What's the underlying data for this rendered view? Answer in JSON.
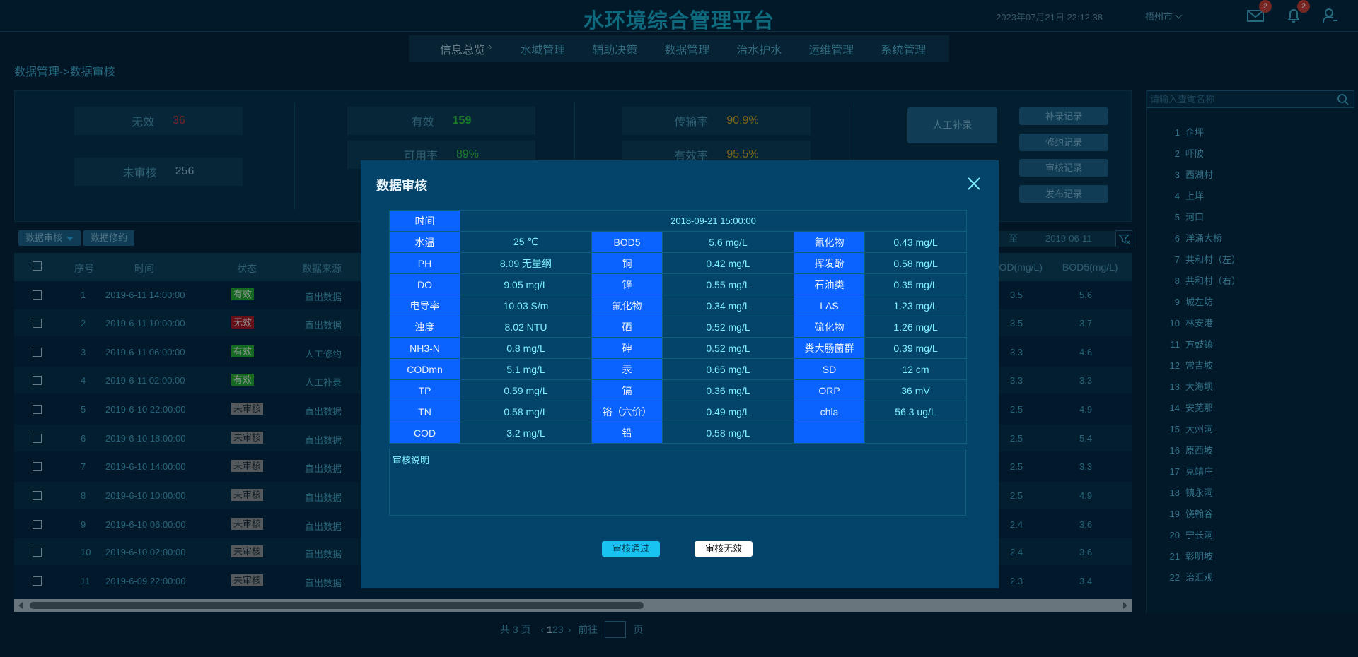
{
  "header": {
    "title": "水环境综合管理平台",
    "datetime": "2023年07月21日 22:12:38",
    "city": "梧州市",
    "mail_count": "2",
    "notify_count": "2"
  },
  "nav": {
    "items": [
      "信息总览",
      "水域管理",
      "辅助决策",
      "数据管理",
      "治水护水",
      "运维管理",
      "系统管理"
    ]
  },
  "breadcrumb": "数据管理->数据审核",
  "stats": {
    "invalid_label": "无效",
    "invalid_value": "36",
    "unreviewed_label": "未审核",
    "unreviewed_value": "256",
    "valid_label": "有效",
    "valid_value": "159",
    "avail_label": "可用率",
    "avail_value": "89%",
    "trans_label": "传输率",
    "trans_value": "90.9%",
    "effect_label": "有效率",
    "effect_value": "95.5%",
    "manual_button": "人工补录",
    "record_buttons": [
      "补录记录",
      "修约记录",
      "审核记录",
      "发布记录"
    ]
  },
  "filters": {
    "audit_dropdown": "数据审核",
    "revise_button": "数据修约",
    "date_sep": "至",
    "date_end": "2019-06-11"
  },
  "table": {
    "headers": {
      "index": "序号",
      "time": "时间",
      "status": "状态",
      "source": "数据来源",
      "cod": "COD(mg/L)",
      "bod": "BOD5(mg/L)"
    },
    "rows": [
      {
        "index": "1",
        "time": "2019-6-11 14:00:00",
        "status": "有效",
        "source": "直出数据",
        "cod": "3.5",
        "bod": "5.6"
      },
      {
        "index": "2",
        "time": "2019-6-11 10:00:00",
        "status": "无效",
        "source": "直出数据",
        "cod": "3.5",
        "bod": "3.7"
      },
      {
        "index": "3",
        "time": "2019-6-11 06:00:00",
        "status": "有效",
        "source": "人工修约",
        "cod": "3.3",
        "bod": "4.6"
      },
      {
        "index": "4",
        "time": "2019-6-11 02:00:00",
        "status": "有效",
        "source": "人工补录",
        "cod": "3.3",
        "bod": "3.3"
      },
      {
        "index": "5",
        "time": "2019-6-10 22:00:00",
        "status": "未审核",
        "source": "直出数据",
        "cod": "2.5",
        "bod": "4.9"
      },
      {
        "index": "6",
        "time": "2019-6-10 18:00:00",
        "status": "未审核",
        "source": "直出数据",
        "cod": "2.5",
        "bod": "5.4"
      },
      {
        "index": "7",
        "time": "2019-6-10 14:00:00",
        "status": "未审核",
        "source": "直出数据",
        "cod": "2.5",
        "bod": "3.3"
      },
      {
        "index": "8",
        "time": "2019-6-10 10:00:00",
        "status": "未审核",
        "source": "直出数据",
        "cod": "2.5",
        "bod": "4.9"
      },
      {
        "index": "9",
        "time": "2019-6-10 06:00:00",
        "status": "未审核",
        "source": "直出数据",
        "cod": "2.4",
        "bod": "3.6"
      },
      {
        "index": "10",
        "time": "2019-6-10 02:00:00",
        "status": "未审核",
        "source": "直出数据",
        "cod": "2.4",
        "bod": "3.6"
      },
      {
        "index": "11",
        "time": "2019-6-09 22:00:00",
        "status": "未审核",
        "source": "直出数据",
        "cod": "2.3",
        "bod": "3.4"
      }
    ],
    "status_colors": {
      "有效": "#22a32a",
      "无效": "#a3151b",
      "未审核": "#8a8a8a"
    }
  },
  "pager": {
    "total": "共 3 页",
    "pages": [
      "1",
      "2",
      "3"
    ],
    "current": "1",
    "goto": "前往",
    "page_unit": "页"
  },
  "sidebar": {
    "search_placeholder": "请输入查询名称",
    "items": [
      {
        "num": "1",
        "name": "企坪"
      },
      {
        "num": "2",
        "name": "吓陂"
      },
      {
        "num": "3",
        "name": "西湖村"
      },
      {
        "num": "4",
        "name": "上垟"
      },
      {
        "num": "5",
        "name": "河口"
      },
      {
        "num": "6",
        "name": "洋涌大桥"
      },
      {
        "num": "7",
        "name": "共和村（左）"
      },
      {
        "num": "8",
        "name": "共和村（右）"
      },
      {
        "num": "9",
        "name": "城左坊"
      },
      {
        "num": "10",
        "name": "林安港"
      },
      {
        "num": "11",
        "name": "方鼓镇"
      },
      {
        "num": "12",
        "name": "常吉坡"
      },
      {
        "num": "13",
        "name": "大海坝"
      },
      {
        "num": "14",
        "name": "安芜那"
      },
      {
        "num": "15",
        "name": "大州洞"
      },
      {
        "num": "16",
        "name": "原西坡"
      },
      {
        "num": "17",
        "name": "克靖庄"
      },
      {
        "num": "18",
        "name": "镇永洞"
      },
      {
        "num": "19",
        "name": "饶翰谷"
      },
      {
        "num": "20",
        "name": "宁长洞"
      },
      {
        "num": "21",
        "name": "彰明坡"
      },
      {
        "num": "22",
        "name": "治汇观"
      }
    ]
  },
  "modal": {
    "title": "数据审核",
    "time_label": "时间",
    "time_value": "2018-09-21 15:00:00",
    "rows": [
      [
        "水温",
        "25 ℃",
        "BOD5",
        "5.6 mg/L",
        "氰化物",
        "0.43 mg/L"
      ],
      [
        "PH",
        "8.09 无量纲",
        "铜",
        "0.42 mg/L",
        "挥发酚",
        "0.58 mg/L"
      ],
      [
        "DO",
        "9.05 mg/L",
        "锌",
        "0.55 mg/L",
        "石油类",
        "0.35 mg/L"
      ],
      [
        "电导率",
        "10.03 S/m",
        "氟化物",
        "0.34 mg/L",
        "LAS",
        "1.23 mg/L"
      ],
      [
        "浊度",
        "8.02 NTU",
        "硒",
        "0.52 mg/L",
        "硫化物",
        "1.26 mg/L"
      ],
      [
        "NH3-N",
        "0.8 mg/L",
        "砷",
        "0.52 mg/L",
        "粪大肠菌群",
        "0.39 mg/L"
      ],
      [
        "CODmn",
        "5.1 mg/L",
        "汞",
        "0.65 mg/L",
        "SD",
        "12 cm"
      ],
      [
        "TP",
        "0.59 mg/L",
        "镉",
        "0.36 mg/L",
        "ORP",
        "36 mV"
      ],
      [
        "TN",
        "0.58 mg/L",
        "铬（六价）",
        "0.49 mg/L",
        "chla",
        "56.3 ug/L"
      ],
      [
        "COD",
        "3.2 mg/L",
        "铅",
        "0.58 mg/L",
        "",
        ""
      ]
    ],
    "notes_label": "审核说明",
    "pass_button": "审核通过",
    "invalid_button": "审核无效"
  }
}
